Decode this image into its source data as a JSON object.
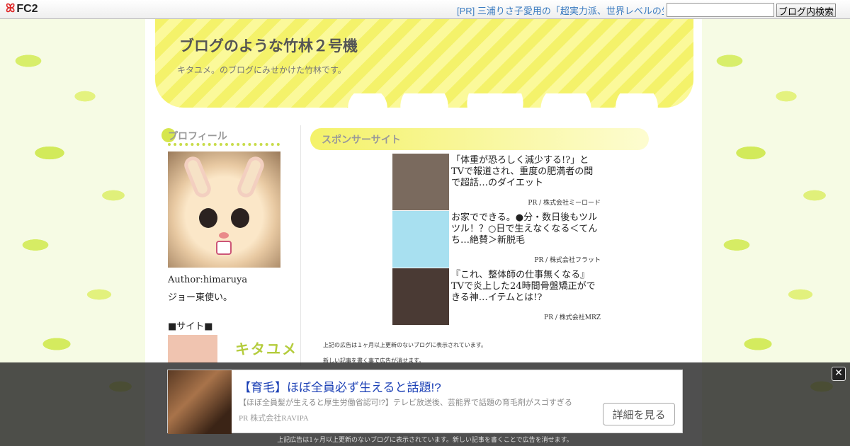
{
  "topbar": {
    "logo_text": "FC2",
    "logo_mark": "ꕤ",
    "pr_text": "[PR] 三浦りさ子愛用の「超実力派、世界レベルの生酵",
    "search_value": "",
    "search_button": "ブログ内検索"
  },
  "header": {
    "title": "ブログのような竹林２号機",
    "description": "キタユメ。のブログにみせかけた竹林です。"
  },
  "sidebar": {
    "profile_heading": "プロフィール",
    "author": "Author:himaruya",
    "author_desc": "ジョー東使い。",
    "site_heading": "■サイト■",
    "site_banner": "キタユメ"
  },
  "main": {
    "heading": "スポンサーサイト",
    "ads": [
      {
        "text": "「体重が恐ろしく減少する!?」とTVで報道され、重度の肥満者の間で超話…のダイエット",
        "pr": "PR / 株式会社ミーロード",
        "color": "#7a6a5e"
      },
      {
        "text": "お家でできる。●分・数日後もツルツル！？○日で生えなくなる＜てんち…絶賛＞新脱毛",
        "pr": "PR / 株式会社フラット",
        "color": "#a8e0f0"
      },
      {
        "text": "『これ、整体師の仕事無くなる』TVで炎上した24時間骨盤矯正ができる神…イテムとは!?",
        "pr": "PR / 株式会社MRZ",
        "color": "#4a3a34"
      }
    ],
    "note1": "上記の広告は１ヶ月以上更新のないブログに表示されています。",
    "note2": "新しい記事を書く事で広告が消せます。"
  },
  "overlay": {
    "close_glyph": "✕",
    "title": "【育毛】ほぼ全員必ず生えると話題!?",
    "desc": "【ほぼ全員髪が生えると厚生労働省認可!?】テレビ放送後、芸能界で話題の育毛剤がスゴすぎる",
    "pr": "PR  株式会社RAVIPA",
    "button": "詳細を見る",
    "note": "上記広告は1ヶ月以上更新のないブログに表示されています。新しい記事を書くことで広告を消せます。"
  }
}
